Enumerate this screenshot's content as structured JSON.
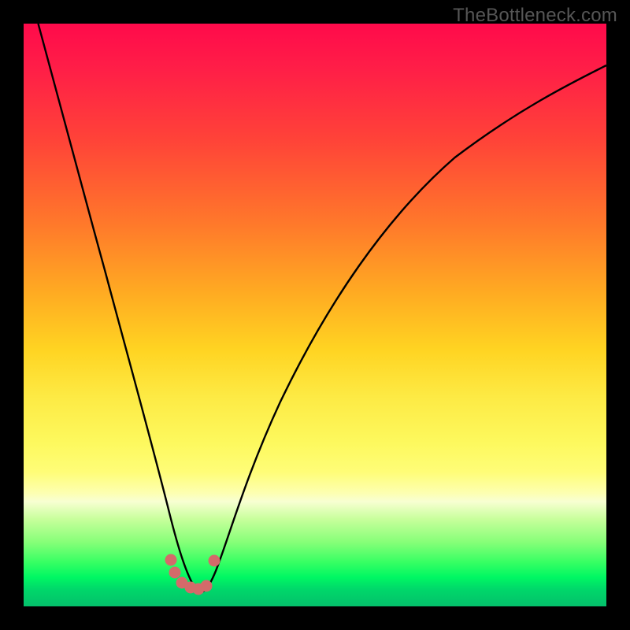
{
  "watermark": "TheBottleneck.com",
  "chart_data": {
    "type": "line",
    "title": "",
    "xlabel": "",
    "ylabel": "",
    "xlim": [
      0,
      1
    ],
    "ylim": [
      0,
      1
    ],
    "notes": "Bottleneck-style curve. X axis: normalized component ratio. Y axis: normalized bottleneck percentage. Background gradient encodes severity (red = high bottleneck, green = balanced). Curve minimum sits near x ≈ 0.295, y ≈ 0.03.",
    "series": [
      {
        "name": "bottleneck-curve",
        "x": [
          0.025,
          0.06,
          0.1,
          0.14,
          0.18,
          0.22,
          0.25,
          0.275,
          0.295,
          0.315,
          0.34,
          0.38,
          0.44,
          0.52,
          0.62,
          0.74,
          0.85,
          0.95,
          1.0
        ],
        "y": [
          1.0,
          0.87,
          0.72,
          0.57,
          0.43,
          0.28,
          0.16,
          0.08,
          0.03,
          0.06,
          0.12,
          0.22,
          0.35,
          0.49,
          0.61,
          0.72,
          0.79,
          0.84,
          0.86
        ]
      }
    ],
    "markers": {
      "name": "minimum-cluster",
      "color": "#d46a6a",
      "points": [
        {
          "x": 0.253,
          "y": 0.08
        },
        {
          "x": 0.26,
          "y": 0.058
        },
        {
          "x": 0.272,
          "y": 0.041
        },
        {
          "x": 0.286,
          "y": 0.032
        },
        {
          "x": 0.3,
          "y": 0.03
        },
        {
          "x": 0.314,
          "y": 0.035
        },
        {
          "x": 0.327,
          "y": 0.078
        }
      ]
    },
    "gradient_stops": [
      {
        "pos": 0.0,
        "color": "#ff0a4b"
      },
      {
        "pos": 0.46,
        "color": "#ffaa22"
      },
      {
        "pos": 0.77,
        "color": "#fffd78"
      },
      {
        "pos": 1.0,
        "color": "#04c06b"
      }
    ]
  }
}
